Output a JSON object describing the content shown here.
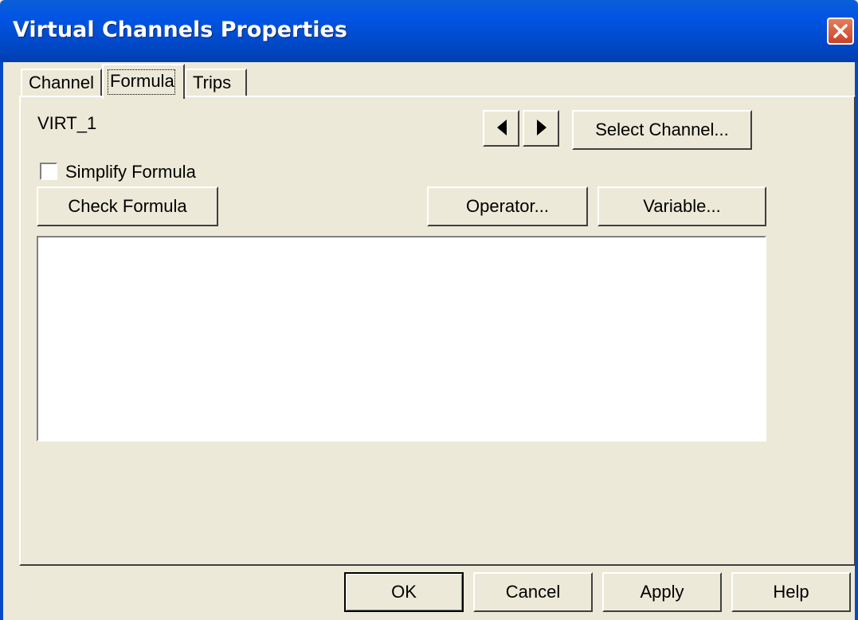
{
  "window": {
    "title": "Virtual Channels Properties",
    "close_icon": "close-icon"
  },
  "tabs": [
    {
      "label": "Channel",
      "active": false
    },
    {
      "label": "Formula",
      "active": true
    },
    {
      "label": "Trips",
      "active": false
    }
  ],
  "formula": {
    "channel_name": "VIRT_1",
    "prev_icon": "triangle-left-icon",
    "next_icon": "triangle-right-icon",
    "select_channel_label": "Select Channel...",
    "simplify_label": "Simplify Formula",
    "simplify_checked": false,
    "check_formula_label": "Check Formula",
    "operator_label": "Operator...",
    "variable_label": "Variable...",
    "formula_text": ""
  },
  "footer": {
    "ok": "OK",
    "cancel": "Cancel",
    "apply": "Apply",
    "help": "Help"
  },
  "colors": {
    "face": "#ECE9D8",
    "title_bar": "#0054E3",
    "close": "#C9432A"
  }
}
